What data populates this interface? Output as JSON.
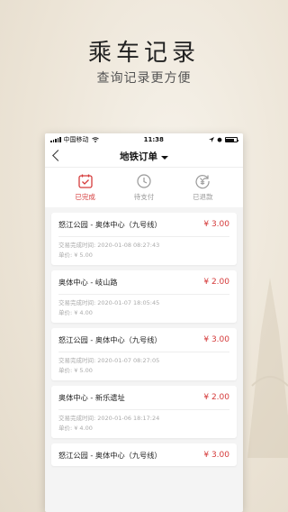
{
  "promo": {
    "title": "乘车记录",
    "subtitle": "查询记录更方便"
  },
  "statusbar": {
    "carrier": "中国移动",
    "time": "11:38"
  },
  "navbar": {
    "title": "地铁订单"
  },
  "tabs": [
    {
      "label": "已完成",
      "icon": "calendar-check-icon",
      "active": true
    },
    {
      "label": "待支付",
      "icon": "clock-icon",
      "active": false
    },
    {
      "label": "已退款",
      "icon": "refund-yuan-icon",
      "active": false
    }
  ],
  "orders": [
    {
      "route": "怒江公园 - 奥体中心（九号线）",
      "price": "¥ 3.00",
      "time_label": "交易完成时间:",
      "time": "2020-01-08 08:27:43",
      "unit_label": "单价:",
      "unit": "¥ 5.00"
    },
    {
      "route": "奥体中心 - 岐山路",
      "price": "¥ 2.00",
      "time_label": "交易完成时间:",
      "time": "2020-01-07 18:05:45",
      "unit_label": "单价:",
      "unit": "¥ 4.00"
    },
    {
      "route": "怒江公园 - 奥体中心（九号线）",
      "price": "¥ 3.00",
      "time_label": "交易完成时间:",
      "time": "2020-01-07 08:27:05",
      "unit_label": "单价:",
      "unit": "¥ 5.00"
    },
    {
      "route": "奥体中心 - 新乐遗址",
      "price": "¥ 2.00",
      "time_label": "交易完成时间:",
      "time": "2020-01-06 18:17:24",
      "unit_label": "单价:",
      "unit": "¥ 4.00"
    },
    {
      "route": "怒江公园 - 奥体中心（九号线）",
      "price": "¥ 3.00",
      "time_label": "",
      "time": "",
      "unit_label": "",
      "unit": ""
    }
  ],
  "colors": {
    "accent": "#d53a3a",
    "inactive": "#999999"
  }
}
